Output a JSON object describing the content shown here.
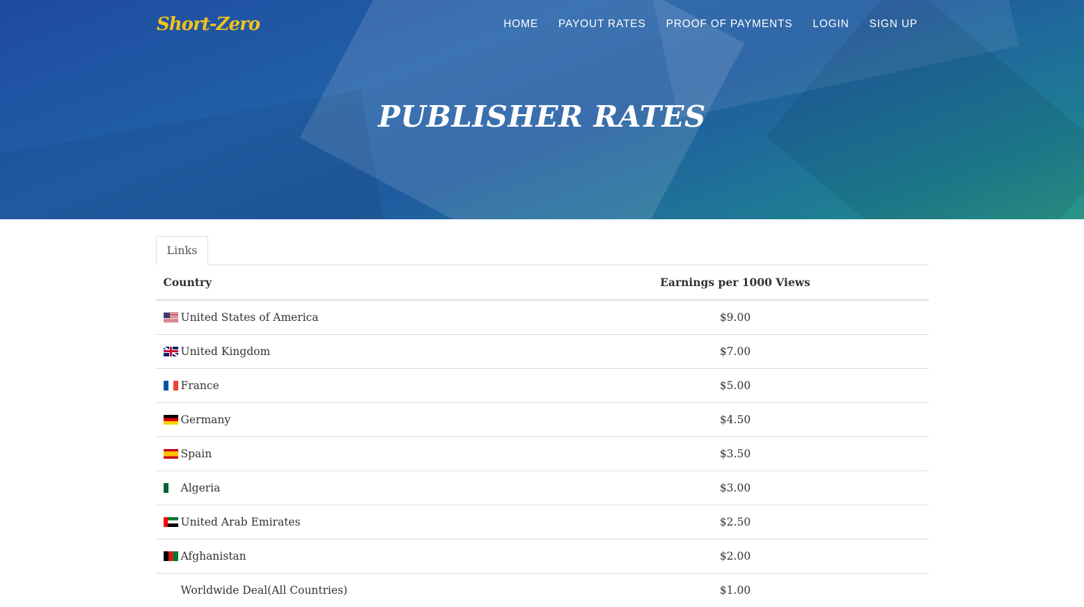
{
  "header": {
    "logo": "Short-Zero",
    "nav": [
      "HOME",
      "PAYOUT RATES",
      "PROOF OF PAYMENTS",
      "LOGIN",
      "SIGN UP"
    ],
    "title": "PUBLISHER RATES"
  },
  "tabs": [
    "Links"
  ],
  "table": {
    "headers": [
      "Country",
      "Earnings per 1000 Views"
    ],
    "rows": [
      {
        "flag": "us-flag-icon",
        "country": "United States of America",
        "rate": "$9.00"
      },
      {
        "flag": "uk-flag-icon",
        "country": "United Kingdom",
        "rate": "$7.00"
      },
      {
        "flag": "france-flag-icon",
        "country": "France",
        "rate": "$5.00"
      },
      {
        "flag": "germany-flag-icon",
        "country": "Germany",
        "rate": "$4.50"
      },
      {
        "flag": "spain-flag-icon",
        "country": "Spain",
        "rate": "$3.50"
      },
      {
        "flag": "algeria-flag-icon",
        "country": "Algeria",
        "rate": "$3.00"
      },
      {
        "flag": "uae-flag-icon",
        "country": "United Arab Emirates",
        "rate": "$2.50"
      },
      {
        "flag": "afghanistan-flag-icon",
        "country": "Afghanistan",
        "rate": "$2.00"
      },
      {
        "flag": "",
        "country": "Worldwide Deal(All Countries)",
        "rate": "$1.00"
      }
    ]
  },
  "colors": {
    "logo": "#f2c21b",
    "hero_start": "#1f4aa0",
    "hero_end": "#2a9688"
  }
}
